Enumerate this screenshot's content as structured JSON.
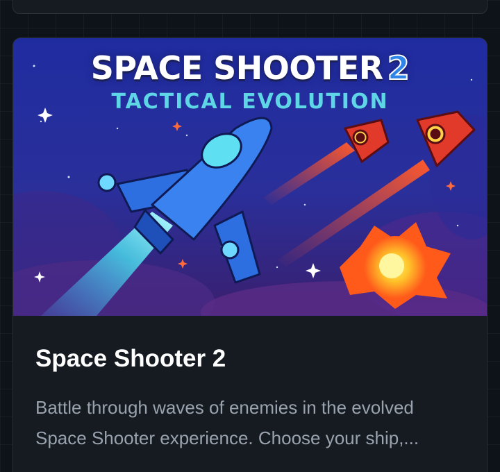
{
  "game_card": {
    "thumbnail": {
      "title_main": "SPACE SHOOTER",
      "title_number": "2",
      "subtitle": "TACTICAL EVOLUTION"
    },
    "title": "Space Shooter 2",
    "description": "Battle through waves of enemies in the evolved Space Shooter experience. Choose your ship,..."
  },
  "colors": {
    "page_background": "#0e131a",
    "card_background": "#161b22",
    "card_border": "#2b313a",
    "title_text": "#ffffff",
    "description_text": "#9aa3ad",
    "thumbnail_subtitle": "#5fd6e6"
  }
}
